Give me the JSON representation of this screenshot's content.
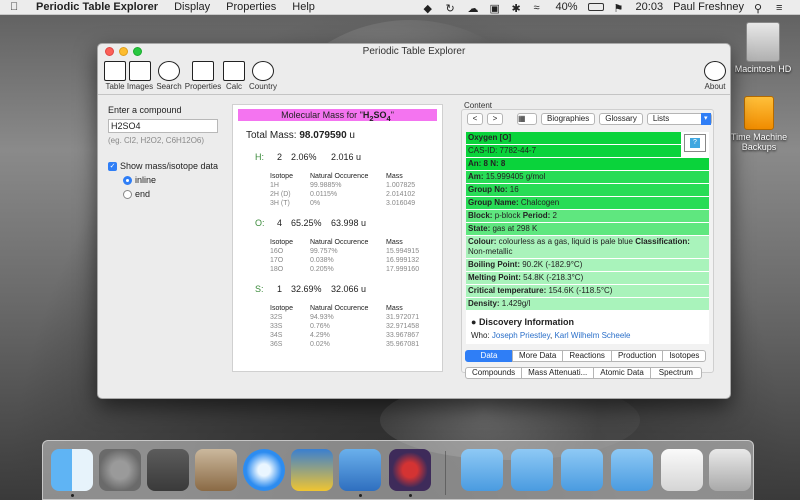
{
  "menubar": {
    "app_name": "Periodic Table Explorer",
    "items": [
      "Display",
      "Properties",
      "Help"
    ],
    "battery": "40%",
    "time": "20:03",
    "user": "Paul Freshney"
  },
  "desktop": {
    "icons": [
      {
        "label": "Macintosh HD"
      },
      {
        "label": "Time Machine Backups"
      }
    ]
  },
  "window": {
    "title": "Periodic Table Explorer",
    "toolbar": {
      "table": "Table",
      "images": "Images",
      "search": "Search",
      "properties": "Properties",
      "calc": "Calc",
      "country": "Country",
      "about": "About"
    },
    "input": {
      "label": "Enter a compound",
      "value": "H2SO4",
      "hint": "(eg. Cl2, H2O2, C6H12O6)",
      "checkbox_label": "Show mass/isotope data",
      "radio_inline": "inline",
      "radio_end": "end"
    },
    "result": {
      "header_prefix": "Molecular Mass for \"",
      "formula_h": "H",
      "formula_h_sub": "2",
      "formula_s": "SO",
      "formula_o_sub": "4",
      "header_suffix": "\"",
      "total_label": "Total Mass:",
      "total_value": "98.079590",
      "total_unit": "u",
      "iso_headers": [
        "Isotope",
        "Natural Occurence",
        "Mass"
      ],
      "elements": [
        {
          "symbol": "H:",
          "count": "2",
          "percent": "2.06%",
          "mass": "2.016 u",
          "isotopes": [
            [
              "1H",
              "99.9885%",
              "1.007825"
            ],
            [
              "2H (D)",
              "0.0115%",
              "2.014102"
            ],
            [
              "3H (T)",
              "0%",
              "3.016049"
            ]
          ]
        },
        {
          "symbol": "O:",
          "count": "4",
          "percent": "65.25%",
          "mass": "63.998 u",
          "isotopes": [
            [
              "16O",
              "99.757%",
              "15.994915"
            ],
            [
              "17O",
              "0.038%",
              "16.999132"
            ],
            [
              "18O",
              "0.205%",
              "17.999160"
            ]
          ]
        },
        {
          "symbol": "S:",
          "count": "1",
          "percent": "32.69%",
          "mass": "32.066 u",
          "isotopes": [
            [
              "32S",
              "94.93%",
              "31.972071"
            ],
            [
              "33S",
              "0.76%",
              "32.971458"
            ],
            [
              "34S",
              "4.29%",
              "33.967867"
            ],
            [
              "36S",
              "0.02%",
              "35.967081"
            ]
          ]
        }
      ]
    },
    "content": {
      "label": "Content",
      "nav_back": "<",
      "nav_fwd": ">",
      "biographies": "Biographies",
      "glossary": "Glossary",
      "lists": "Lists",
      "props": {
        "name": "Oxygen [O]",
        "cas": "CAS-ID: 7782-44-7",
        "an": "An: 8 N: 8",
        "am_label": "Am:",
        "am_value": "15.999405 g/mol",
        "group_label": "Group No:",
        "group_value": "16",
        "group_name_label": "Group Name:",
        "group_name_value": "Chalcogen",
        "block_label": "Block:",
        "block_value": "p-block",
        "period_label": "Period:",
        "period_value": "2",
        "state_label": "State:",
        "state_value": "gas at 298 K",
        "colour_label": "Colour:",
        "colour_value": "colourless as a gas, liquid is pale blue",
        "class_label": "Classification:",
        "class_value": "Non-metallic",
        "bp_label": "Boiling Point:",
        "bp_value": "90.2K (-182.9°C)",
        "mp_label": "Melting Point:",
        "mp_value": "54.8K (-218.3°C)",
        "ct_label": "Critical temperature:",
        "ct_value": "154.6K (-118.5°C)",
        "density_label": "Density:",
        "density_value": "1.429g/l"
      },
      "discovery_title": "Discovery Information",
      "who_label": "Who:",
      "who_1": "Joseph Priestley",
      "who_2": "Karl Wilhelm Scheele",
      "tabs_row1": [
        "Data",
        "More Data",
        "Reactions",
        "Production",
        "Isotopes"
      ],
      "tabs_row2": [
        "Compounds",
        "Mass Attenuati...",
        "Atomic Data",
        "Spectrum"
      ]
    }
  }
}
